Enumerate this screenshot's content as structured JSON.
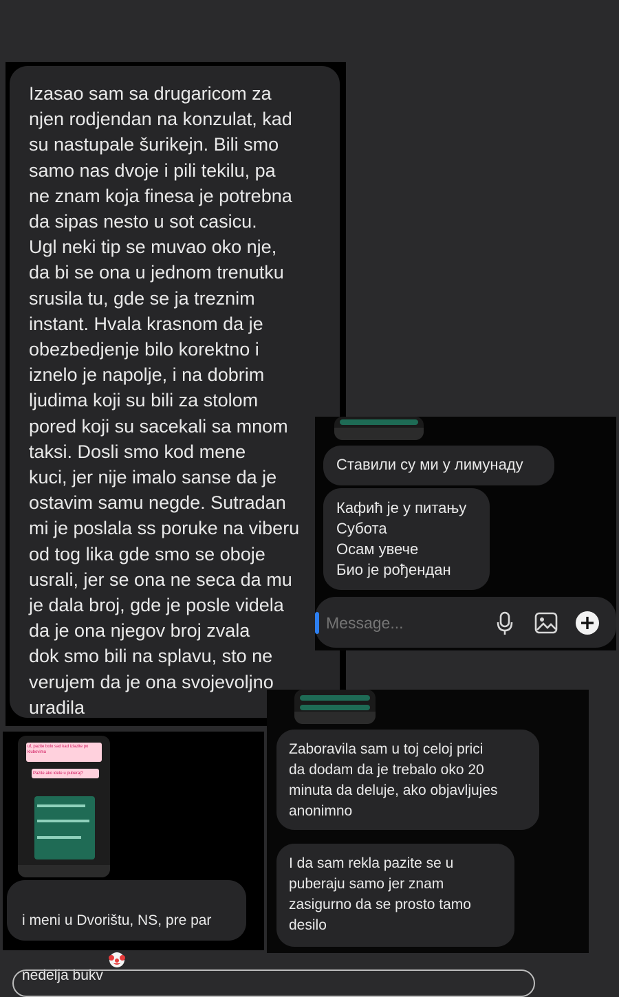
{
  "left_screenshot": {
    "long_message": "Izasao sam sa drugaricom za\nnjen rodjendan na konzulat, kad\nsu nastupale šurikejn. Bili smo\nsamo nas dvoje i pili tekilu, pa\nne znam koja finesa je potrebna\nda sipas nesto u sot casicu.\nUgl neki tip se muvao oko nje,\nda bi se ona u jednom trenutku\nsrusila tu, gde se ja treznim\ninstant. Hvala krasnom da je\nobezbedjenje bilo korektno i\niznelo je napolje, i na dobrim\nljudima koji su bili za stolom\npored koji su sacekali sa mnom\ntaksi. Dosli smo kod mene\nkuci, jer nije imalo sanse da je\nostavim samu negde. Sutradan\nmi je poslala ss poruke na viberu\nod tog lika gde smo se oboje\nusrali, jer se ona ne seca da mu\nje dala broj, gde je posle videla\nda je ona njegov broj zvala\ndok smo bili na splavu, sto ne\nverujem da je ona svojevoljno\nuradila"
  },
  "cyrillic_screenshot": {
    "messages": [
      "Ставили су ми у лимунаду",
      "Кафић је у питању\nСубота\nОсам увече\nБио је рођендан"
    ],
    "composer": {
      "placeholder": "Message...",
      "icons": [
        "microphone-icon",
        "image-icon",
        "plus-icon"
      ]
    }
  },
  "bottom_left_screenshot": {
    "thumbnail_caption": "uf, pazite bolo sad kad izlazite po klubovima",
    "thumbnail_question": "Pazite ako idete u puberaj?",
    "message": "i meni u Dvorištu, NS, pre par\nnedelja bukv",
    "emoji": "clown-face"
  },
  "bottom_right_screenshot": {
    "messages": [
      "Zaboravila sam u toj celoj prici\nda dodam da je trebalo oko 20\nminuta da deluje, ako objavljujes\nanonimno",
      "I da sam rekla pazite se u\npuberaju samo jer znam\nzasigurno da se prosto tamo\ndesilo"
    ]
  }
}
